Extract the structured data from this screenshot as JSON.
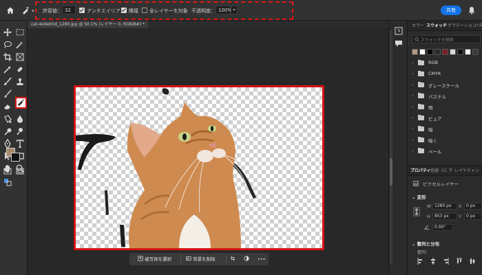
{
  "options_bar": {
    "tolerance_label": "許容値：",
    "tolerance_value": "32",
    "antialias_label": "アンチエイリアス",
    "contiguous_label": "隣接",
    "all_layers_label": "全レイヤーを対象",
    "opacity_label": "不透明度：",
    "opacity_value": "100%",
    "share_label": "共有"
  },
  "document": {
    "tab_title": "cat-4e9eb5d_1280.jpg @ 50.1% (レイヤー 0, RGB/8#) *"
  },
  "taskbar": {
    "select_subject": "被写体を選択",
    "remove_background": "背景を削除",
    "more": "•••"
  },
  "swatches_panel": {
    "tabs": [
      "カラー",
      "スウォッチ",
      "グラデーション",
      "パターン"
    ],
    "search_placeholder": "スウォッチを検索",
    "recent_colors": [
      "#b09a86",
      "#ffffff",
      "#000000",
      "#2a2a2a",
      "#7a1f2a",
      "#d8d8d8",
      "#101010",
      "#f2f2f2",
      "#3a3a3a"
    ],
    "groups": [
      "RGB",
      "CMYK",
      "グレースケール",
      "パステル",
      "明",
      "ピュア",
      "暗",
      "暗く",
      "ペール"
    ]
  },
  "properties_panel": {
    "tabs": [
      "プロパティ",
      "色調",
      "CC ラ",
      "レイヤ",
      "チャン"
    ],
    "layer_type": "ピクセルレイヤー",
    "transform_title": "変形",
    "w_label": "W",
    "w_value": "1280 px",
    "h_label": "H",
    "h_value": "853 px",
    "x_label": "X",
    "x_value": "0 px",
    "y_label": "Y",
    "y_value": "0 px",
    "angle_value": "0.00°",
    "align_title": "整列と分布",
    "align_sub": "整列："
  },
  "colors": {
    "accent": "#1473e6",
    "highlight_red": "#e01818",
    "foreground": "#a68a6c",
    "background": "#111111"
  }
}
